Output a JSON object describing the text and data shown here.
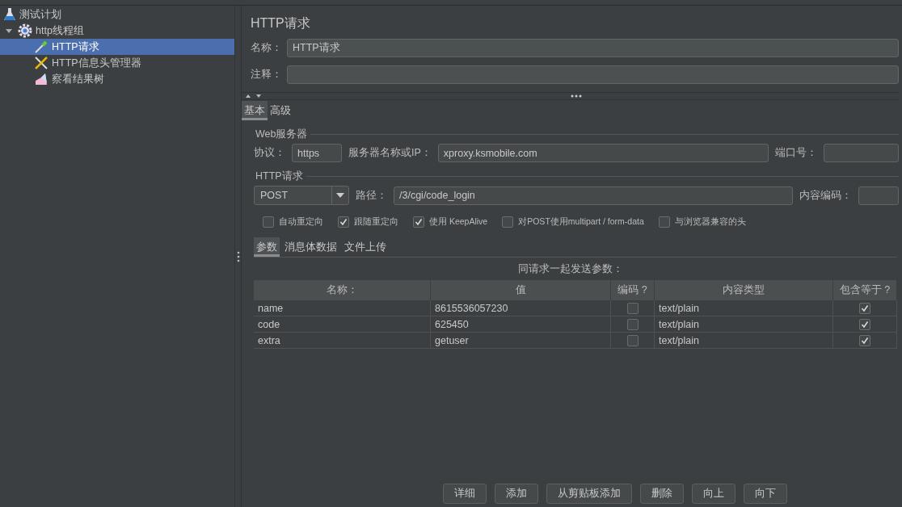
{
  "tree": [
    {
      "label": "测试计划",
      "kind": "plan",
      "selected": false,
      "children": [
        {
          "label": "http线程组",
          "kind": "group",
          "selected": false,
          "expanded": true,
          "children": [
            {
              "label": "HTTP请求",
              "kind": "sampler",
              "selected": true
            },
            {
              "label": "HTTP信息头管理器",
              "kind": "config",
              "selected": false
            },
            {
              "label": "察看结果树",
              "kind": "listener",
              "selected": false
            }
          ]
        }
      ]
    }
  ],
  "title": "HTTP请求",
  "name_field": {
    "label": "名称：",
    "value": "HTTP请求"
  },
  "comment_field": {
    "label": "注释："
  },
  "tabs": [
    {
      "label": "基本",
      "selected": true
    },
    {
      "label": "高级",
      "selected": false
    }
  ],
  "web_server": {
    "legend": "Web服务器",
    "protocol": {
      "label": "协议：",
      "value": "https"
    },
    "server": {
      "label": "服务器名称或IP：",
      "value": "xproxy.ksmobile.com"
    },
    "port": {
      "label": "端口号："
    }
  },
  "http_request": {
    "legend": "HTTP请求",
    "method": "POST",
    "path": {
      "label": "路径：",
      "value": "/3/cgi/code_login"
    },
    "encoding": {
      "label": "内容编码："
    }
  },
  "options": [
    {
      "label": "自动重定向",
      "checked": false
    },
    {
      "label": "跟随重定向",
      "checked": true
    },
    {
      "label": "使用 KeepAlive",
      "checked": true
    },
    {
      "label": "对POST使用multipart / form-data",
      "checked": false
    },
    {
      "label": "与浏览器兼容的头",
      "checked": false
    }
  ],
  "param_tabs": [
    {
      "label": "参数",
      "selected": true
    },
    {
      "label": "消息体数据",
      "selected": false
    },
    {
      "label": "文件上传",
      "selected": false
    }
  ],
  "caption": "同请求一起发送参数：",
  "table": {
    "columns": [
      "名称：",
      "值",
      "编码 ?",
      "内容类型",
      "包含等于 ?"
    ],
    "rows": [
      {
        "name": "name",
        "value": "8615536057230",
        "encode": false,
        "content_type": "text/plain",
        "include_equals": true
      },
      {
        "name": "code",
        "value": "625450",
        "encode": false,
        "content_type": "text/plain",
        "include_equals": true
      },
      {
        "name": "extra",
        "value": "getuser",
        "encode": false,
        "content_type": "text/plain",
        "include_equals": true
      }
    ]
  },
  "buttons": [
    "详细",
    "添加",
    "从剪贴板添加",
    "删除",
    "向上",
    "向下"
  ]
}
